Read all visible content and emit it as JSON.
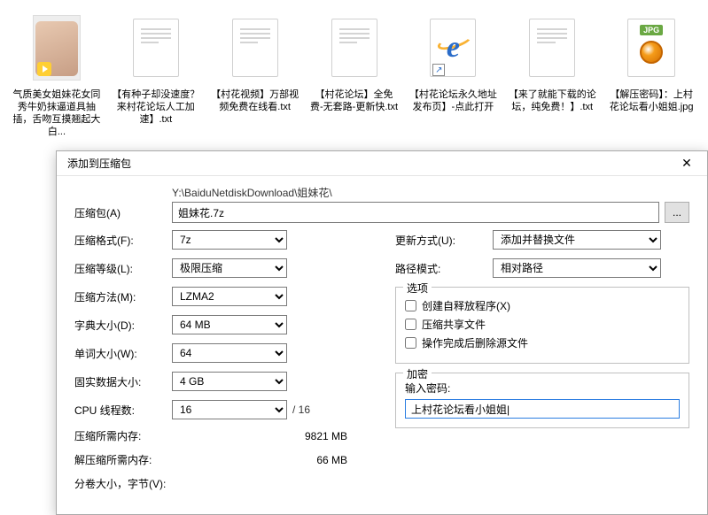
{
  "files": [
    {
      "label": "气质美女姐妹花女同秀牛奶抹逼道具抽插，舌吻互摸翘起大白...",
      "type": "thumb"
    },
    {
      "label": "【有种子却没速度？来村花论坛人工加速】.txt",
      "type": "txt"
    },
    {
      "label": "【村花视频】万部视频免费在线看.txt",
      "type": "txt"
    },
    {
      "label": "【村花论坛】全免费-无套路-更新快.txt",
      "type": "txt"
    },
    {
      "label": "【村花论坛永久地址发布页】-点此打开",
      "type": "ie"
    },
    {
      "label": "【来了就能下载的论坛，纯免费！】.txt",
      "type": "txt"
    },
    {
      "label": "【解压密码】：上村花论坛看小姐姐.jpg",
      "type": "jpg"
    }
  ],
  "dialog": {
    "title": "添加到压缩包",
    "archive_lbl": "压缩包(A)",
    "path": "Y:\\BaiduNetdiskDownload\\姐妹花\\",
    "archive_value": "姐妹花.7z",
    "browse": "...",
    "left": {
      "format_lbl": "压缩格式(F):",
      "format_val": "7z",
      "level_lbl": "压缩等级(L):",
      "level_val": "极限压缩",
      "method_lbl": "压缩方法(M):",
      "method_val": "LZMA2",
      "dict_lbl": "字典大小(D):",
      "dict_val": "64 MB",
      "word_lbl": "单词大小(W):",
      "word_val": "64",
      "solid_lbl": "固实数据大小:",
      "solid_val": "4 GB",
      "cpu_lbl": "CPU 线程数:",
      "cpu_val": "16",
      "cpu_total": "/ 16",
      "mem_c_lbl": "压缩所需内存:",
      "mem_c_val": "9821 MB",
      "mem_d_lbl": "解压缩所需内存:",
      "mem_d_val": "66 MB",
      "split_lbl": "分卷大小，字节(V):"
    },
    "right": {
      "update_lbl": "更新方式(U):",
      "update_val": "添加并替换文件",
      "pathmode_lbl": "路径模式:",
      "pathmode_val": "相对路径",
      "options_title": "选项",
      "opt_sfx": "创建自释放程序(X)",
      "opt_share": "压缩共享文件",
      "opt_delete": "操作完成后删除源文件",
      "enc_title": "加密",
      "pw_lbl": "输入密码:",
      "pw_val": "上村花论坛看小姐姐|"
    }
  },
  "jpg_badge": "JPG"
}
